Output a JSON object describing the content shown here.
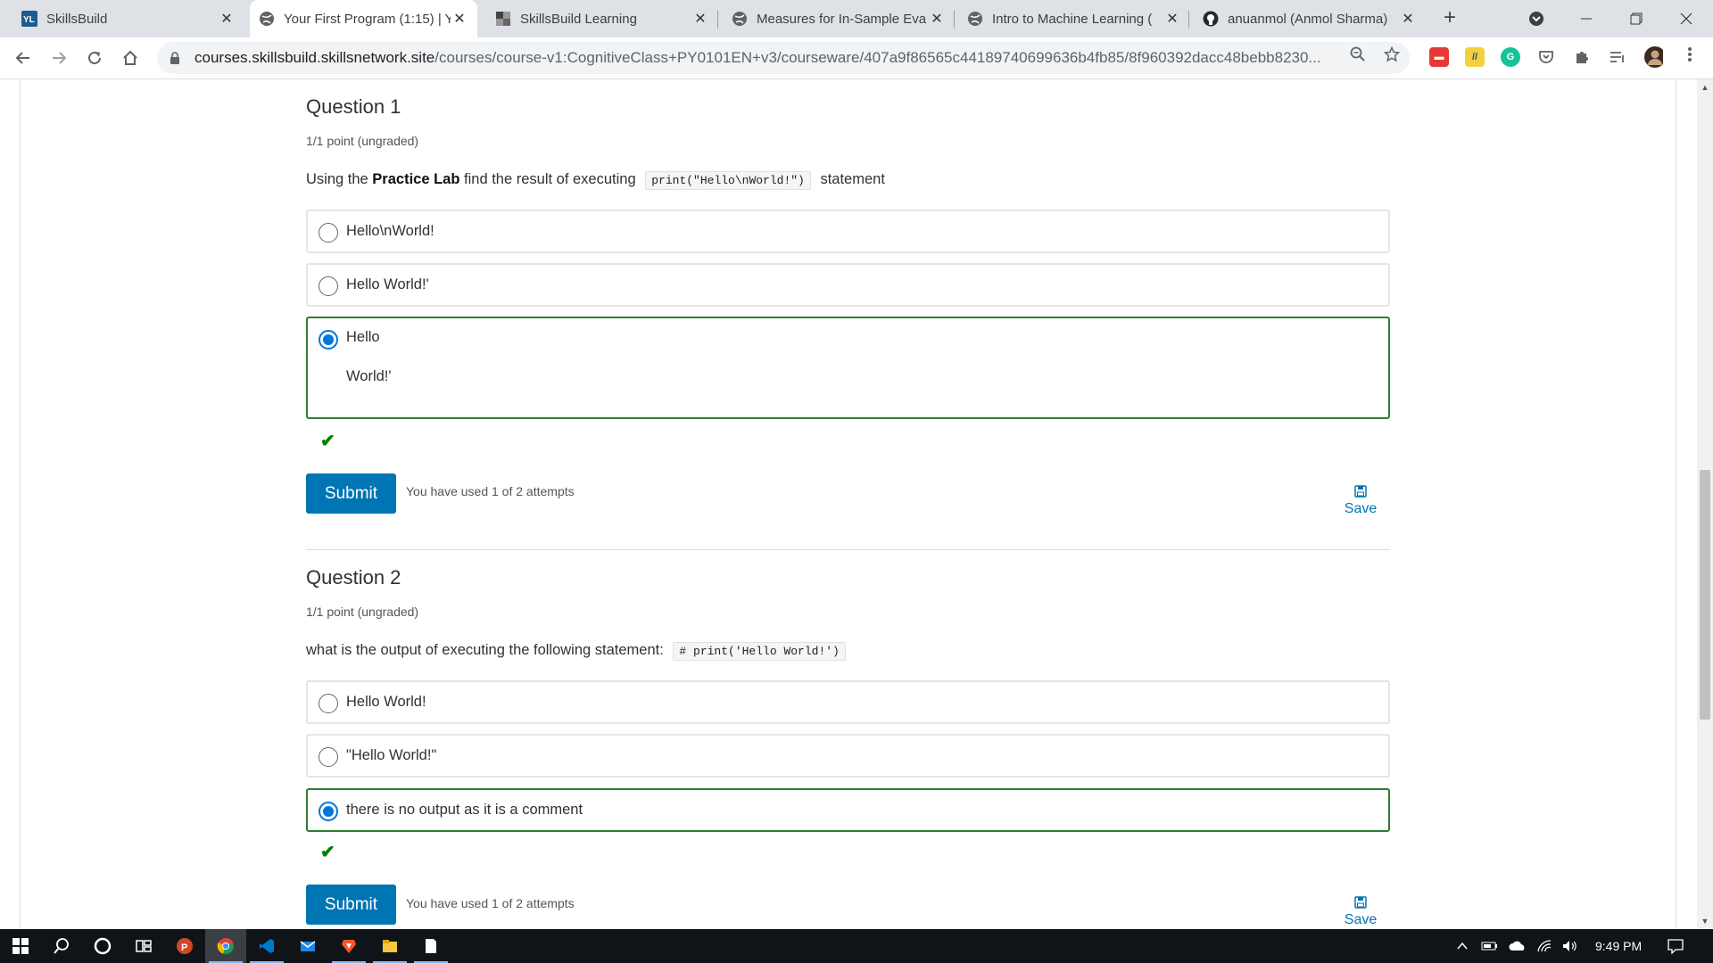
{
  "browser": {
    "tabs": [
      {
        "title": "SkillsBuild",
        "icon": "yl-logo-icon",
        "active": false
      },
      {
        "title": "Your First Program (1:15) | Y",
        "icon": "globe-icon",
        "active": true
      },
      {
        "title": "SkillsBuild Learning",
        "icon": "skillsbuild-icon",
        "active": false
      },
      {
        "title": "Measures for In-Sample Eva",
        "icon": "globe-icon",
        "active": false
      },
      {
        "title": "Intro to Machine Learning (",
        "icon": "globe-icon",
        "active": false
      },
      {
        "title": "anuanmol (Anmol Sharma)",
        "icon": "github-icon",
        "active": false
      }
    ],
    "new_tab_label": "+",
    "url_host": "courses.skillsbuild.skillsnetwork.site",
    "url_path": "/courses/course-v1:CognitiveClass+PY0101EN+v3/courseware/407a9f86565c44189740699636b4fb85/8f960392dacc48bebb8230..."
  },
  "questions": [
    {
      "title": "Question 1",
      "meta": "1/1 point (ungraded)",
      "prompt_before": "Using the ",
      "prompt_bold": "Practice Lab",
      "prompt_middle": " find the result of executing ",
      "prompt_code": "print(\"Hello\\nWorld!\")",
      "prompt_after": " statement",
      "choices": [
        {
          "lines": [
            "Hello\\nWorld!"
          ],
          "selected": false
        },
        {
          "lines": [
            "Hello World!'"
          ],
          "selected": false
        },
        {
          "lines": [
            "Hello",
            "World!'"
          ],
          "selected": true
        }
      ],
      "attempts": "You have used 1 of 2 attempts",
      "submit_label": "Submit",
      "save_label": "Save"
    },
    {
      "title": "Question 2",
      "meta": "1/1 point (ungraded)",
      "prompt_before": "what is the output of executing the following statement: ",
      "prompt_code": "# print('Hello World!')",
      "choices": [
        {
          "lines": [
            "Hello World!"
          ],
          "selected": false
        },
        {
          "lines": [
            "\"Hello World!\""
          ],
          "selected": false
        },
        {
          "lines": [
            "there is no output as it is a comment"
          ],
          "selected": true
        }
      ],
      "attempts": "You have used 1 of 2 attempts",
      "submit_label": "Submit",
      "save_label": "Save"
    }
  ],
  "taskbar": {
    "time": "9:49 PM",
    "apps": [
      "windows-start-icon",
      "search-icon",
      "cortana-icon",
      "task-view-icon",
      "powerpoint-icon",
      "chrome-icon",
      "vscode-icon",
      "mail-icon",
      "brave-icon",
      "file-explorer-icon",
      "notepad-icon"
    ]
  },
  "colors": {
    "accent": "#0075b4",
    "correct": "#008100",
    "selected_border": "#2e7d32",
    "radio": "#0075db"
  }
}
